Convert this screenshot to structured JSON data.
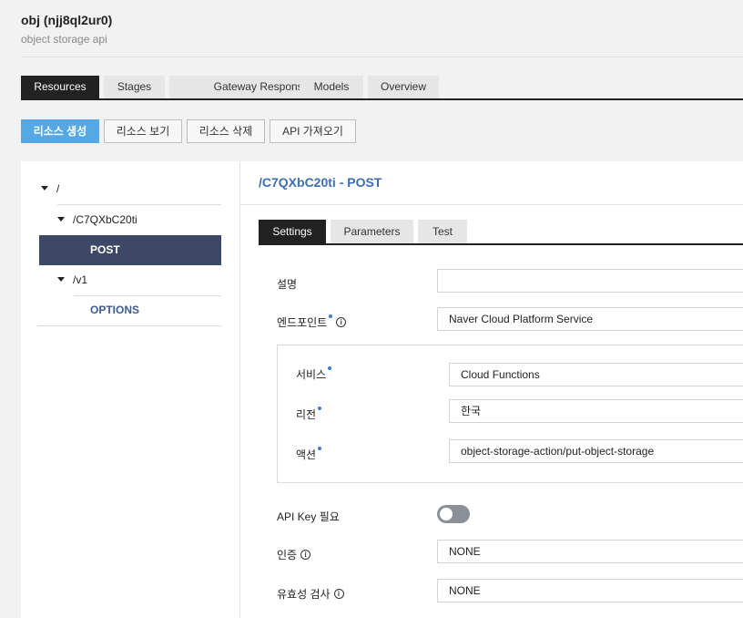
{
  "header": {
    "title": "obj (njj8ql2ur0)",
    "subtitle": "object storage api"
  },
  "tabs": [
    {
      "label": "Resources",
      "active": true
    },
    {
      "label": "Stages",
      "active": false
    },
    {
      "label": "Gateway Responses",
      "active": false
    },
    {
      "label": "Models",
      "active": false
    },
    {
      "label": "Overview",
      "active": false
    }
  ],
  "actions": {
    "create": "리소스 생성",
    "view": "리소스 보기",
    "delete": "리소스 삭제",
    "import": "API 가져오기"
  },
  "tree": {
    "root": "/",
    "res1": "/C7QXbC20ti",
    "res1_method": "POST",
    "res2": "/v1",
    "res2_method": "OPTIONS"
  },
  "main": {
    "title": "/C7QXbC20ti - POST",
    "subtabs": [
      {
        "label": "Settings",
        "active": true
      },
      {
        "label": "Parameters",
        "active": false
      },
      {
        "label": "Test",
        "active": false
      }
    ],
    "settings": {
      "description_label": "설명",
      "description_value": "",
      "endpoint_label": "엔드포인트",
      "endpoint_value": "Naver Cloud Platform Service",
      "service_label": "서비스",
      "service_value": "Cloud Functions",
      "region_label": "리전",
      "region_value": "한국",
      "action_label": "액션",
      "action_value": "object-storage-action/put-object-storage",
      "apikey_label": "API Key 필요",
      "apikey_enabled": false,
      "auth_label": "인증",
      "auth_value": "NONE",
      "validation_label": "유효성 검사",
      "validation_value": "NONE"
    }
  },
  "colors": {
    "accent": "#55a8e4",
    "selected": "#3d4766",
    "title": "#3a6fb5",
    "required_dot": "#3a7bd5"
  }
}
